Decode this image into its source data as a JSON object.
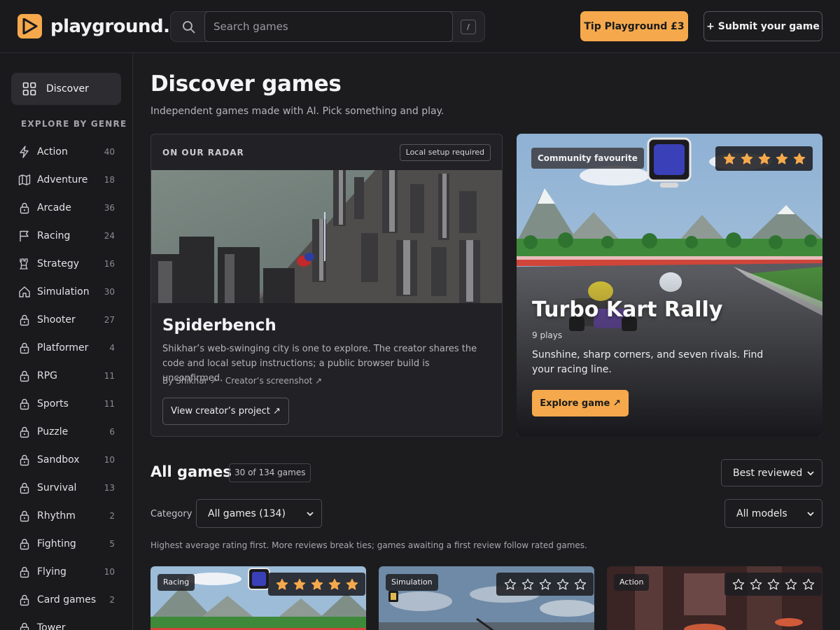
{
  "brand": {
    "name": "playground.",
    "accent": "#f5a94c"
  },
  "search": {
    "placeholder": "Search games",
    "shortcut": "/"
  },
  "header": {
    "tip_label": "Tip Playground £3",
    "submit_label": "+ Submit your game"
  },
  "sidebar": {
    "discover_label": "Discover",
    "genre_heading": "EXPLORE BY GENRE",
    "genres": [
      {
        "name": "Action",
        "count": "40",
        "icon": "bolt-icon"
      },
      {
        "name": "Adventure",
        "count": "18",
        "icon": "map-icon"
      },
      {
        "name": "Arcade",
        "count": "36",
        "icon": "lock-icon"
      },
      {
        "name": "Racing",
        "count": "24",
        "icon": "flag-icon"
      },
      {
        "name": "Strategy",
        "count": "16",
        "icon": "castle-icon"
      },
      {
        "name": "Simulation",
        "count": "30",
        "icon": "home-icon"
      },
      {
        "name": "Shooter",
        "count": "27",
        "icon": "lock-icon"
      },
      {
        "name": "Platformer",
        "count": "4",
        "icon": "lock-icon"
      },
      {
        "name": "RPG",
        "count": "11",
        "icon": "lock-icon"
      },
      {
        "name": "Sports",
        "count": "11",
        "icon": "lock-icon"
      },
      {
        "name": "Puzzle",
        "count": "6",
        "icon": "lock-icon"
      },
      {
        "name": "Sandbox",
        "count": "10",
        "icon": "lock-icon"
      },
      {
        "name": "Survival",
        "count": "13",
        "icon": "lock-icon"
      },
      {
        "name": "Rhythm",
        "count": "2",
        "icon": "lock-icon"
      },
      {
        "name": "Fighting",
        "count": "5",
        "icon": "lock-icon"
      },
      {
        "name": "Flying",
        "count": "10",
        "icon": "lock-icon"
      },
      {
        "name": "Card games",
        "count": "2",
        "icon": "lock-icon"
      },
      {
        "name": "Tower",
        "count": "",
        "icon": "lock-icon"
      }
    ]
  },
  "main": {
    "title": "Discover games",
    "subtitle": "Independent games made with AI. Pick something and play."
  },
  "radar": {
    "label": "ON OUR RADAR",
    "badge": "Local setup required",
    "title": "Spiderbench",
    "description": "Shikhar’s web-swinging city is one to explore. The creator shares the code and local setup instructions; a public browser build is unconfirmed.",
    "by": "By Shikhar ↗ · Creator’s screenshot ↗",
    "button": "View creator’s project ↗"
  },
  "featured": {
    "badge": "Community favourite",
    "rating": 5,
    "title": "Turbo Kart Rally",
    "plays": "9 plays",
    "description": "Sunshine, sharp corners, and seven rivals. Find your racing line.",
    "button": "Explore game ↗"
  },
  "all_games": {
    "title": "All games",
    "count": "30 of 134 games",
    "sort": "Best reviewed",
    "category_label": "Category",
    "category": "All games (134)",
    "models": "All models",
    "note": "Highest average rating first. More reviews break ties; games awaiting a first review follow rated games."
  },
  "cards": [
    {
      "tag": "Racing",
      "rating": 5
    },
    {
      "tag": "Simulation",
      "rating": 0
    },
    {
      "tag": "Action",
      "rating": 0
    }
  ],
  "colors": {
    "star_filled": "#f5a94c",
    "star_empty": "#e6e6e6"
  }
}
